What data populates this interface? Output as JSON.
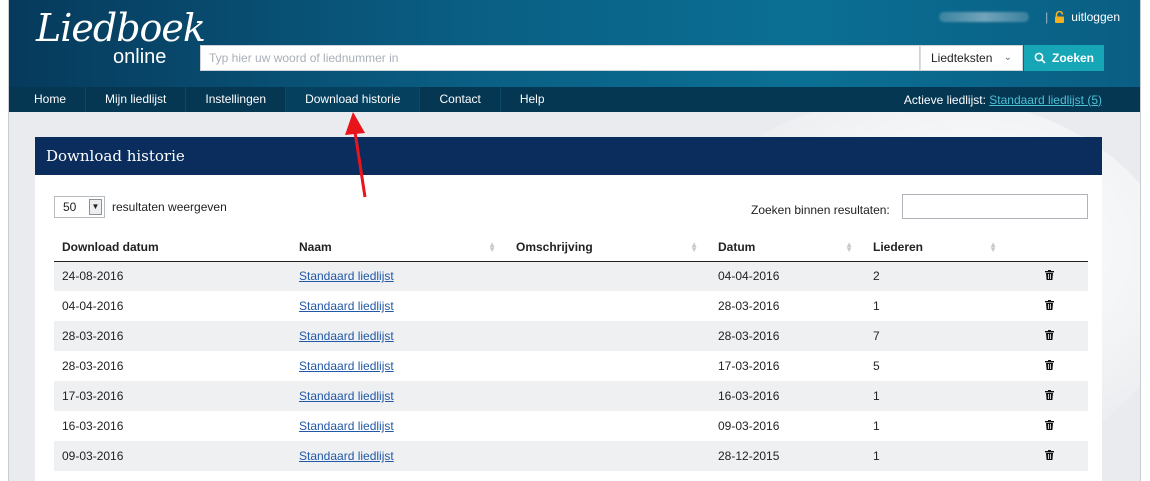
{
  "header": {
    "logo_main": "Liedboek",
    "logo_sub": "online",
    "search_placeholder": "Typ hier uw woord of liednummer in",
    "search_type": "Liedteksten",
    "search_button": "Zoeken",
    "user_separator": "|",
    "logout_label": "uitloggen"
  },
  "nav": {
    "items": [
      "Home",
      "Mijn liedlijst",
      "Instellingen",
      "Download historie",
      "Contact",
      "Help"
    ],
    "active": "Download historie",
    "active_list_label": "Actieve liedlijst:",
    "active_list_link": "Standaard liedlijst (5)"
  },
  "panel": {
    "title": "Download historie",
    "page_size": "50",
    "page_size_label": "resultaten weergeven",
    "filter_label": "Zoeken binnen resultaten:",
    "columns": [
      "Download datum",
      "Naam",
      "Omschrijving",
      "Datum",
      "Liederen"
    ],
    "rows": [
      {
        "download": "24-08-2016",
        "naam": "Standaard liedlijst",
        "omschrijving": "",
        "datum": "04-04-2016",
        "liederen": "2"
      },
      {
        "download": "04-04-2016",
        "naam": "Standaard liedlijst",
        "omschrijving": "",
        "datum": "28-03-2016",
        "liederen": "1"
      },
      {
        "download": "28-03-2016",
        "naam": "Standaard liedlijst",
        "omschrijving": "",
        "datum": "28-03-2016",
        "liederen": "7"
      },
      {
        "download": "28-03-2016",
        "naam": "Standaard liedlijst",
        "omschrijving": "",
        "datum": "17-03-2016",
        "liederen": "5"
      },
      {
        "download": "17-03-2016",
        "naam": "Standaard liedlijst",
        "omschrijving": "",
        "datum": "16-03-2016",
        "liederen": "1"
      },
      {
        "download": "16-03-2016",
        "naam": "Standaard liedlijst",
        "omschrijving": "",
        "datum": "09-03-2016",
        "liederen": "1"
      },
      {
        "download": "09-03-2016",
        "naam": "Standaard liedlijst",
        "omschrijving": "",
        "datum": "28-12-2015",
        "liederen": "1"
      }
    ]
  },
  "colors": {
    "header": "#0a5e83",
    "nav": "#053752",
    "panel_title": "#0a2d5e",
    "search_button": "#17a6b6",
    "link": "#2158a8",
    "annotation_arrow": "#e8141c"
  },
  "icons": {
    "search": "magnifier-icon",
    "logout": "padlock-icon",
    "row_action": "trash-icon"
  }
}
